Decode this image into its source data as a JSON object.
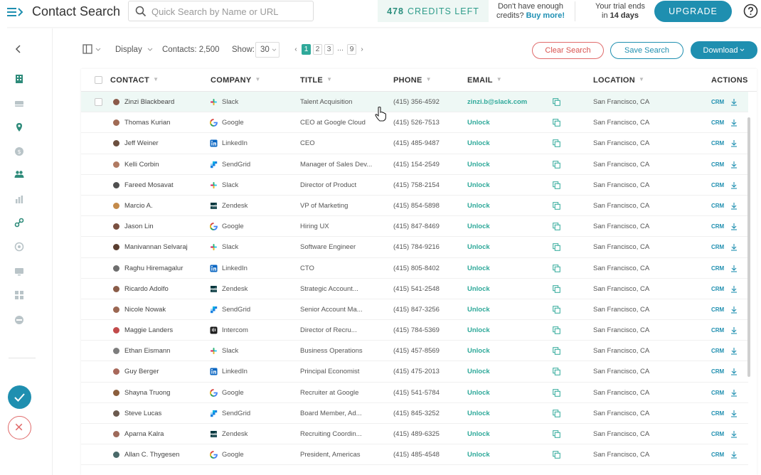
{
  "header": {
    "title": "Contact Search",
    "search_placeholder": "Quick Search by Name or URL",
    "credits_count": "478",
    "credits_label": "CREDITS LEFT",
    "credits_note_line1": "Don't have enough",
    "credits_note_line2": "credits?",
    "buy_more": "Buy more!",
    "trial_line1": "Your trial ends",
    "trial_line2_prefix": "in",
    "trial_days": "14 days",
    "upgrade_label": "UPGRADE"
  },
  "toolbar": {
    "display_label": "Display",
    "contacts_label": "Contacts:",
    "contacts_count": "2,500",
    "show_label": "Show:",
    "show_value": "30",
    "pages": [
      "1",
      "2",
      "3",
      "...",
      "9"
    ],
    "clear_search": "Clear Search",
    "save_search": "Save Search",
    "download": "Download"
  },
  "table": {
    "columns": [
      "CONTACT",
      "COMPANY",
      "TITLE",
      "PHONE",
      "EMAIL",
      "LOCATION",
      "ACTIONS"
    ],
    "crm_label": "CRM",
    "rows": [
      {
        "contact": "Zinzi Blackbeard",
        "company": "Slack",
        "title": "Talent Acquisition",
        "phone": "(415) 356-4592",
        "email": "zinzi.b@slack.com",
        "location": "San Francisco, CA"
      },
      {
        "contact": "Thomas Kurian",
        "company": "Google",
        "title": "CEO at Google Cloud",
        "phone": "(415) 526-7513",
        "email": "Unlock",
        "location": "San Francisco, CA"
      },
      {
        "contact": "Jeff Weiner",
        "company": "LinkedIn",
        "title": "CEO",
        "phone": "(415) 485-9487",
        "email": "Unlock",
        "location": "San Francisco, CA"
      },
      {
        "contact": "Kelli Corbin",
        "company": "SendGrid",
        "title": "Manager of Sales Dev...",
        "phone": "(415) 154-2549",
        "email": "Unlock",
        "location": "San Francisco, CA"
      },
      {
        "contact": "Fareed Mosavat",
        "company": "Slack",
        "title": "Director of Product",
        "phone": "(415) 758-2154",
        "email": "Unlock",
        "location": "San Francisco, CA"
      },
      {
        "contact": "Marcio A.",
        "company": "Zendesk",
        "title": "VP of Marketing",
        "phone": "(415) 854-5898",
        "email": "Unlock",
        "location": "San Francisco, CA"
      },
      {
        "contact": "Jason Lin",
        "company": "Google",
        "title": "Hiring UX",
        "phone": "(415) 847-8469",
        "email": "Unlock",
        "location": "San Francisco, CA"
      },
      {
        "contact": "Manivannan Selvaraj",
        "company": "Slack",
        "title": "Software Engineer",
        "phone": "(415) 784-9216",
        "email": "Unlock",
        "location": "San Francisco, CA"
      },
      {
        "contact": "Raghu Hiremagalur",
        "company": "LinkedIn",
        "title": "CTO",
        "phone": "(415) 805-8402",
        "email": "Unlock",
        "location": "San Francisco, CA"
      },
      {
        "contact": "Ricardo Adolfo",
        "company": "Zendesk",
        "title": "Strategic Account...",
        "phone": "(415) 541-2548",
        "email": "Unlock",
        "location": "San Francisco, CA"
      },
      {
        "contact": "Nicole Nowak",
        "company": "SendGrid",
        "title": "Senior Account Ma...",
        "phone": "(415) 847-3256",
        "email": "Unlock",
        "location": "San Francisco, CA"
      },
      {
        "contact": "Maggie Landers",
        "company": "Intercom",
        "title": "Director of Recru...",
        "phone": "(415) 784-5369",
        "email": "Unlock",
        "location": "San Francisco, CA"
      },
      {
        "contact": "Ethan Eismann",
        "company": "Slack",
        "title": "Business Operations",
        "phone": "(415) 457-8569",
        "email": "Unlock",
        "location": "San Francisco, CA"
      },
      {
        "contact": "Guy Berger",
        "company": "LinkedIn",
        "title": "Principal Economist",
        "phone": "(415) 475-2013",
        "email": "Unlock",
        "location": "San Francisco, CA"
      },
      {
        "contact": "Shayna Truong",
        "company": "Google",
        "title": "Recruiter at Google",
        "phone": "(415) 541-5784",
        "email": "Unlock",
        "location": "San Francisco, CA"
      },
      {
        "contact": "Steve Lucas",
        "company": "SendGrid",
        "title": "Board Member, Ad...",
        "phone": "(415) 845-3252",
        "email": "Unlock",
        "location": "San Francisco, CA"
      },
      {
        "contact": "Aparna Kalra",
        "company": "Zendesk",
        "title": "Recruiting Coordin...",
        "phone": "(415) 489-6325",
        "email": "Unlock",
        "location": "San Francisco, CA"
      },
      {
        "contact": "Allan C. Thygesen",
        "company": "Google",
        "title": "President, Americas",
        "phone": "(415) 485-4548",
        "email": "Unlock",
        "location": "San Francisco, CA"
      }
    ]
  },
  "icons": {
    "company": {
      "Slack": "slack-logo-icon",
      "Google": "google-logo-icon",
      "LinkedIn": "linkedin-logo-icon",
      "SendGrid": "sendgrid-logo-icon",
      "Zendesk": "zendesk-logo-icon",
      "Intercom": "intercom-logo-icon"
    }
  },
  "colors": {
    "primary": "#1f8fb0",
    "accent_green": "#2fa99a",
    "danger": "#d9534f",
    "hover_row": "#eef8f5"
  }
}
